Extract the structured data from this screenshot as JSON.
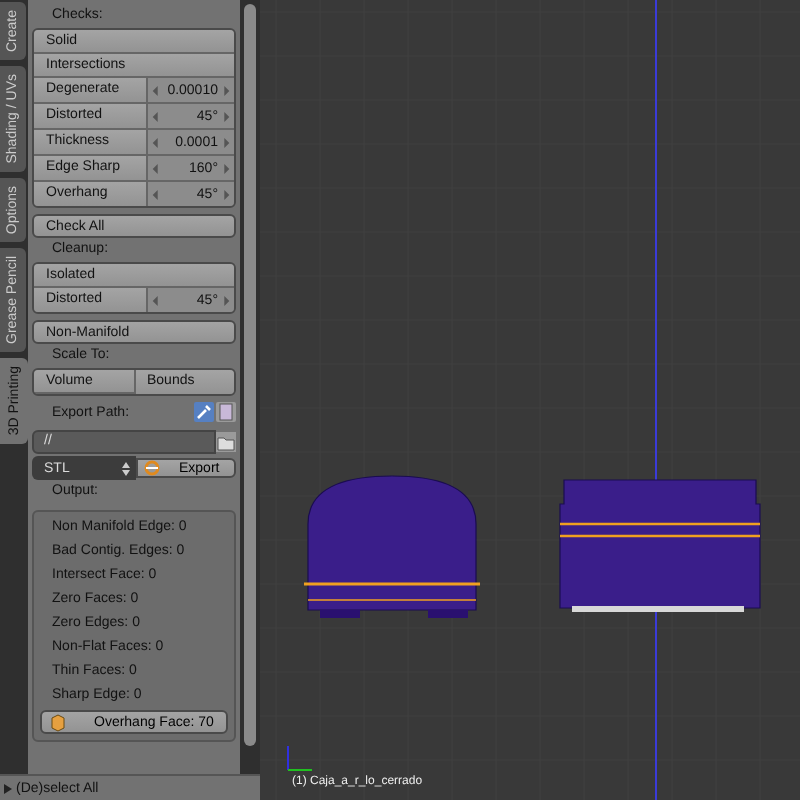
{
  "tabs": [
    {
      "label": "Create",
      "selected": false
    },
    {
      "label": "Shading / UVs",
      "selected": false
    },
    {
      "label": "Options",
      "selected": false
    },
    {
      "label": "Grease Pencil",
      "selected": false
    },
    {
      "label": "3D Printing",
      "selected": true
    }
  ],
  "checks": {
    "title": "Checks:",
    "buttons": [
      "Solid",
      "Intersections"
    ],
    "fields": [
      {
        "label": "Degenerate",
        "value": "0.00010"
      },
      {
        "label": "Distorted",
        "value": "45°"
      },
      {
        "label": "Thickness",
        "value": "0.0001"
      },
      {
        "label": "Edge Sharp",
        "value": "160°"
      },
      {
        "label": "Overhang",
        "value": "45°"
      }
    ],
    "check_all": "Check All"
  },
  "cleanup": {
    "title": "Cleanup:",
    "buttons": [
      "Isolated"
    ],
    "fields": [
      {
        "label": "Distorted",
        "value": "45°"
      }
    ],
    "non_manifold": "Non-Manifold"
  },
  "scale_to": {
    "title": "Scale To:",
    "buttons": [
      "Volume",
      "Bounds"
    ]
  },
  "export": {
    "title": "Export Path:",
    "path": "//",
    "format": "STL",
    "button": "Export"
  },
  "output": {
    "title": "Output:",
    "lines": [
      "Non Manifold Edge: 0",
      "Bad Contig. Edges: 0",
      "Intersect Face: 0",
      "Zero Faces: 0",
      "Zero Edges: 0",
      "Non-Flat Faces: 0",
      "Thin Faces: 0",
      "Sharp Edge: 0"
    ],
    "overhang": "Overhang Face: 70"
  },
  "viewport": {
    "object_label": "(1) Caja_a_r_lo_cerrado"
  },
  "operator": "(De)select All"
}
